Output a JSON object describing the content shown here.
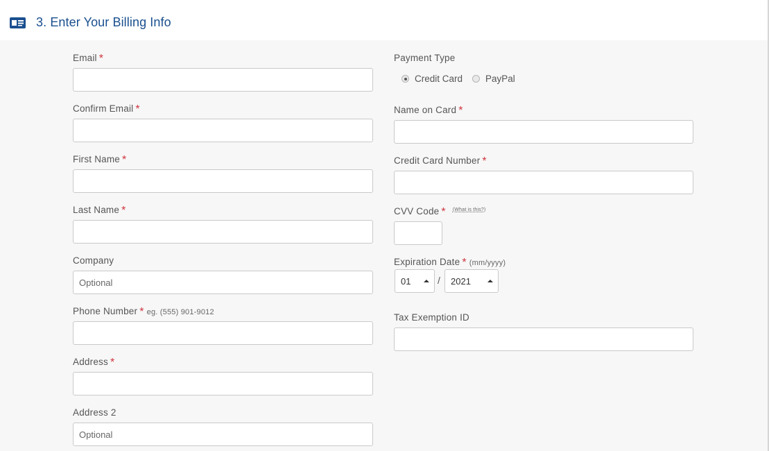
{
  "header": {
    "title": "3. Enter Your Billing Info"
  },
  "left_fields": [
    {
      "label": "Email",
      "required": "*",
      "value": "",
      "placeholder": ""
    },
    {
      "label": "Confirm Email",
      "required": "*",
      "value": "",
      "placeholder": ""
    },
    {
      "label": "First Name",
      "required": "*",
      "value": "",
      "placeholder": ""
    },
    {
      "label": "Last Name",
      "required": "*",
      "value": "",
      "placeholder": ""
    },
    {
      "label": "Company",
      "required": "",
      "value": "",
      "placeholder": "Optional"
    },
    {
      "label": "Phone Number",
      "required": "*",
      "hint": "eg. (555) 901-9012",
      "value": "",
      "placeholder": ""
    },
    {
      "label": "Address",
      "required": "*",
      "value": "",
      "placeholder": ""
    },
    {
      "label": "Address 2",
      "required": "",
      "value": "",
      "placeholder": "Optional"
    }
  ],
  "payment": {
    "label": "Payment Type",
    "options": [
      {
        "label": "Credit Card",
        "checked": true
      },
      {
        "label": "PayPal",
        "checked": false
      }
    ]
  },
  "name_on_card": {
    "label": "Name on Card",
    "required": "*"
  },
  "card_number": {
    "label": "Credit Card Number",
    "required": "*"
  },
  "cvv": {
    "label": "CVV Code",
    "required": "*",
    "help": "(What is this?)"
  },
  "expiration": {
    "label": "Expiration Date",
    "required": "*",
    "hint": "(mm/yyyy)",
    "month": "01",
    "separator": "/",
    "year": "2021"
  },
  "tax": {
    "label": "Tax Exemption ID"
  }
}
